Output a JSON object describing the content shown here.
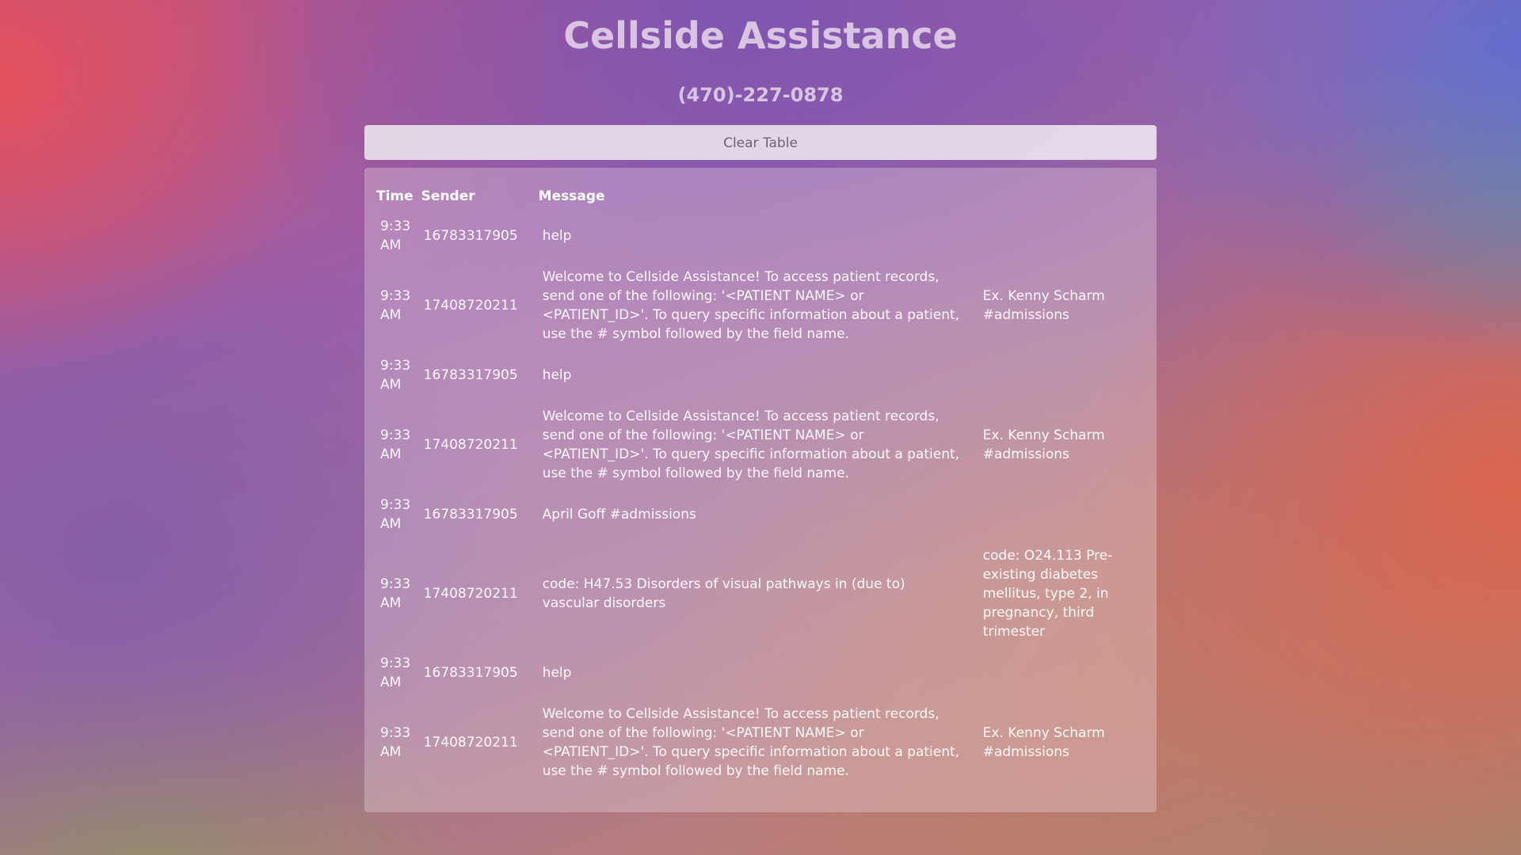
{
  "header": {
    "title": "Cellside Assistance",
    "phone": "(470)-227-0878"
  },
  "toolbar": {
    "clear_label": "Clear Table"
  },
  "table": {
    "columns": [
      "Time",
      "Sender",
      "Message"
    ],
    "rows": [
      {
        "time": "9:33 AM",
        "sender": "16783317905",
        "message": "help",
        "extra": ""
      },
      {
        "time": "9:33 AM",
        "sender": "17408720211",
        "message": "Welcome to Cellside Assistance! To access patient records, send one of the following: '<PATIENT NAME> or <PATIENT_ID>'. To query specific information about a patient, use the # symbol followed by the field name.",
        "extra": "Ex. Kenny Scharm #admissions"
      },
      {
        "time": "9:33 AM",
        "sender": "16783317905",
        "message": "help",
        "extra": ""
      },
      {
        "time": "9:33 AM",
        "sender": "17408720211",
        "message": "Welcome to Cellside Assistance! To access patient records, send one of the following: '<PATIENT NAME> or <PATIENT_ID>'. To query specific information about a patient, use the # symbol followed by the field name.",
        "extra": "Ex. Kenny Scharm #admissions"
      },
      {
        "time": "9:33 AM",
        "sender": "16783317905",
        "message": "April Goff #admissions",
        "extra": ""
      },
      {
        "time": "9:33 AM",
        "sender": "17408720211",
        "message": "code: H47.53 Disorders of visual pathways in (due to) vascular disorders",
        "extra": "code: O24.113 Pre-existing diabetes mellitus, type 2, in pregnancy, third trimester"
      },
      {
        "time": "9:33 AM",
        "sender": "16783317905",
        "message": "help",
        "extra": ""
      },
      {
        "time": "9:33 AM",
        "sender": "17408720211",
        "message": "Welcome to Cellside Assistance! To access patient records, send one of the following: '<PATIENT NAME> or <PATIENT_ID>'. To query specific information about a patient, use the # symbol followed by the field name.",
        "extra": "Ex. Kenny Scharm #admissions"
      }
    ]
  }
}
